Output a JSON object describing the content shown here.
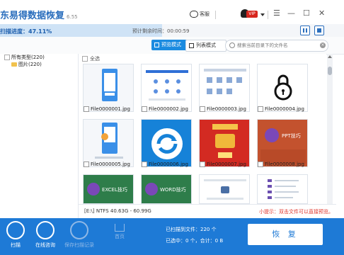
{
  "app": {
    "title": "东易得数据恢复",
    "version": "6.55"
  },
  "titlebar": {
    "chat_label": "客服",
    "vip_badge": "VIP"
  },
  "progress": {
    "label": "扫描进度：47.11%",
    "value_percent": 47.11,
    "remaining_label": "预计剩余时间：00:00:59"
  },
  "toolbar": {
    "thumbnail_mode": "预览模式",
    "list_mode": "列表模式",
    "search_placeholder": "搜索当前目录下的文件名",
    "clear_glyph": "×"
  },
  "tree": {
    "all_types": "所有类型(220)",
    "images": "图片(220)"
  },
  "grid": {
    "select_all": "全选",
    "files": [
      {
        "name": "File0000001.jpg",
        "icon": "phone-app-thumb"
      },
      {
        "name": "File0000002.jpg",
        "icon": "web-page-thumb"
      },
      {
        "name": "File0000003.jpg",
        "icon": "web-page-thumb"
      },
      {
        "name": "File0000004.jpg",
        "icon": "lock-thumb"
      },
      {
        "name": "File0000005.jpg",
        "icon": "phone-app-thumb"
      },
      {
        "name": "File0000006.jpg",
        "icon": "refresh-logo-thumb"
      },
      {
        "name": "File0000007.jpg",
        "icon": "promo-red-thumb"
      },
      {
        "name": "File0000008.jpg",
        "icon": "ppt-tips-thumb"
      },
      {
        "name": "EXCEL技巧",
        "icon": "excel-tips-thumb"
      },
      {
        "name": "WORD技巧",
        "icon": "word-tips-thumb"
      },
      {
        "name": "",
        "icon": "web-page-thumb"
      },
      {
        "name": "",
        "icon": "list-page-thumb"
      }
    ],
    "ppt_caption": "PPT技巧"
  },
  "status": {
    "disk_info": "[E:\\] NTFS 40.63G - 60.99G",
    "tip": "小提示：双击文件可以直接预览。"
  },
  "bottom": {
    "nav": [
      {
        "label": "扫描",
        "icon": "scan-icon"
      },
      {
        "label": "在线咨询",
        "icon": "support-icon"
      },
      {
        "label": "保存扫描记录",
        "icon": "save-record-icon"
      }
    ],
    "home_label": "首页",
    "scan_count": "已扫描到文件：220 个",
    "selected": "已选中：0 个，合计：0 B",
    "recover_label": "恢 复"
  },
  "colors": {
    "accent": "#1e7ad6",
    "tip": "#e0352b"
  }
}
